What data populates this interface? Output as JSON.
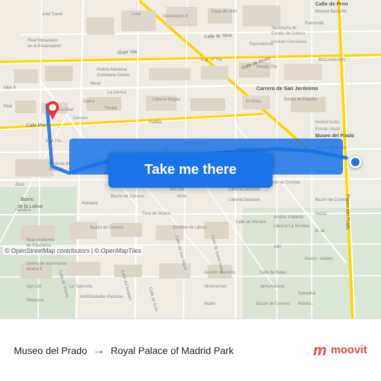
{
  "map": {
    "attribution": "© OpenStreetMap contributors | © OpenMapTiles",
    "bg_color": "#f0ebe3",
    "route_color": "#1a73e8",
    "highlight_color": "#1a73e8"
  },
  "button": {
    "label": "Take me there"
  },
  "bottom_bar": {
    "origin": "Museo del Prado",
    "destination": "Royal Palace of Madrid Park",
    "arrow": "→",
    "logo_letter": "m",
    "logo_text": "moovit"
  }
}
